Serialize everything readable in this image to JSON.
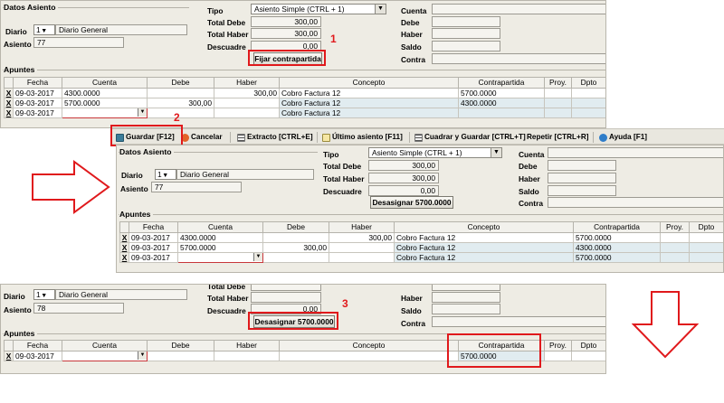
{
  "panel1": {
    "group_title": "Datos Asiento",
    "diario_label": "Diario",
    "diario_num": "1",
    "diario_name": "Diario General",
    "asiento_label": "Asiento",
    "asiento_value": "77",
    "tipo_label": "Tipo",
    "tipo_value": "Asiento Simple (CTRL + 1)",
    "total_debe_label": "Total Debe",
    "total_debe": "300,00",
    "total_haber_label": "Total Haber",
    "total_haber": "300,00",
    "descuadre_label": "Descuadre",
    "descuadre": "0,00",
    "fix_button": "Fijar contrapartida",
    "cuenta_label": "Cuenta",
    "debe_label": "Debe",
    "haber_label": "Haber",
    "saldo_label": "Saldo",
    "contra_label": "Contra",
    "apuntes_title": "Apuntes",
    "marker": "1",
    "rows": [
      {
        "x": "X",
        "fecha": "09-03-2017",
        "cuenta": "4300.0000",
        "debe": "",
        "haber": "300,00",
        "concepto": "Cobro Factura 12",
        "contrapartida": "5700.0000"
      },
      {
        "x": "X",
        "fecha": "09-03-2017",
        "cuenta": "5700.0000",
        "debe": "300,00",
        "haber": "",
        "concepto": "Cobro Factura 12",
        "contrapartida": "4300.0000"
      },
      {
        "x": "X",
        "fecha": "09-03-2017",
        "cuenta": "",
        "debe": "",
        "haber": "",
        "concepto": "Cobro Factura 12",
        "contrapartida": ""
      }
    ]
  },
  "columns": [
    "Fecha",
    "Cuenta",
    "Debe",
    "Haber",
    "Concepto",
    "Contrapartida",
    "Proy.",
    "Dpto"
  ],
  "toolbar": {
    "marker": "2",
    "guardar": "Guardar [F12]",
    "cancelar": "Cancelar",
    "extracto": "Extracto [CTRL+E]",
    "ultimo": "Último asiento [F11]",
    "cuadrar": "Cuadrar y Guardar [CTRL+T]",
    "repetir": "Repetir [CTRL+R]",
    "ayuda": "Ayuda [F1]"
  },
  "panel2": {
    "group_title": "Datos Asiento",
    "diario_label": "Diario",
    "diario_num": "1",
    "diario_name": "Diario General",
    "asiento_label": "Asiento",
    "asiento_value": "77",
    "tipo_label": "Tipo",
    "tipo_value": "Asiento Simple (CTRL + 1)",
    "total_debe_label": "Total Debe",
    "total_debe": "300,00",
    "total_haber_label": "Total Haber",
    "total_haber": "300,00",
    "descuadre_label": "Descuadre",
    "descuadre": "0,00",
    "unassign_button": "Desasignar 5700.0000",
    "cuenta_label": "Cuenta",
    "debe_label": "Debe",
    "haber_label": "Haber",
    "saldo_label": "Saldo",
    "contra_label": "Contra",
    "apuntes_title": "Apuntes",
    "rows": [
      {
        "x": "X",
        "fecha": "09-03-2017",
        "cuenta": "4300.0000",
        "debe": "",
        "haber": "300,00",
        "concepto": "Cobro Factura 12",
        "contrapartida": "5700.0000"
      },
      {
        "x": "X",
        "fecha": "09-03-2017",
        "cuenta": "5700.0000",
        "debe": "300,00",
        "haber": "",
        "concepto": "Cobro Factura 12",
        "contrapartida": "4300.0000"
      },
      {
        "x": "X",
        "fecha": "09-03-2017",
        "cuenta": "",
        "debe": "",
        "haber": "",
        "concepto": "Cobro Factura 12",
        "contrapartida": "5700.0000"
      }
    ]
  },
  "panel3": {
    "diario_label": "Diario",
    "diario_num": "1",
    "diario_name": "Diario General",
    "asiento_label": "Asiento",
    "asiento_value": "78",
    "total_debe_label": "Total Debe",
    "total_haber_label": "Total Haber",
    "descuadre_label": "Descuadre",
    "descuadre": "0,00",
    "unassign_button": "Desasignar 5700.0000",
    "haber_label": "Haber",
    "saldo_label": "Saldo",
    "contra_label": "Contra",
    "apuntes_title": "Apuntes",
    "marker": "3",
    "rows": [
      {
        "x": "X",
        "fecha": "09-03-2017",
        "cuenta": "",
        "debe": "",
        "haber": "",
        "concepto": "",
        "contrapartida": "5700.0000"
      }
    ]
  },
  "colors": {
    "highlight": "#e0191c",
    "panel": "#eeece4",
    "contra_cell": "#e1ecf0"
  },
  "icons": {
    "save": "floppy-disk-icon",
    "cancel": "cancel-circle-icon",
    "extract": "list-icon",
    "last": "search-document-icon",
    "help": "help-icon",
    "right_arrow": "right-arrow",
    "down_arrow": "down-arrow"
  }
}
